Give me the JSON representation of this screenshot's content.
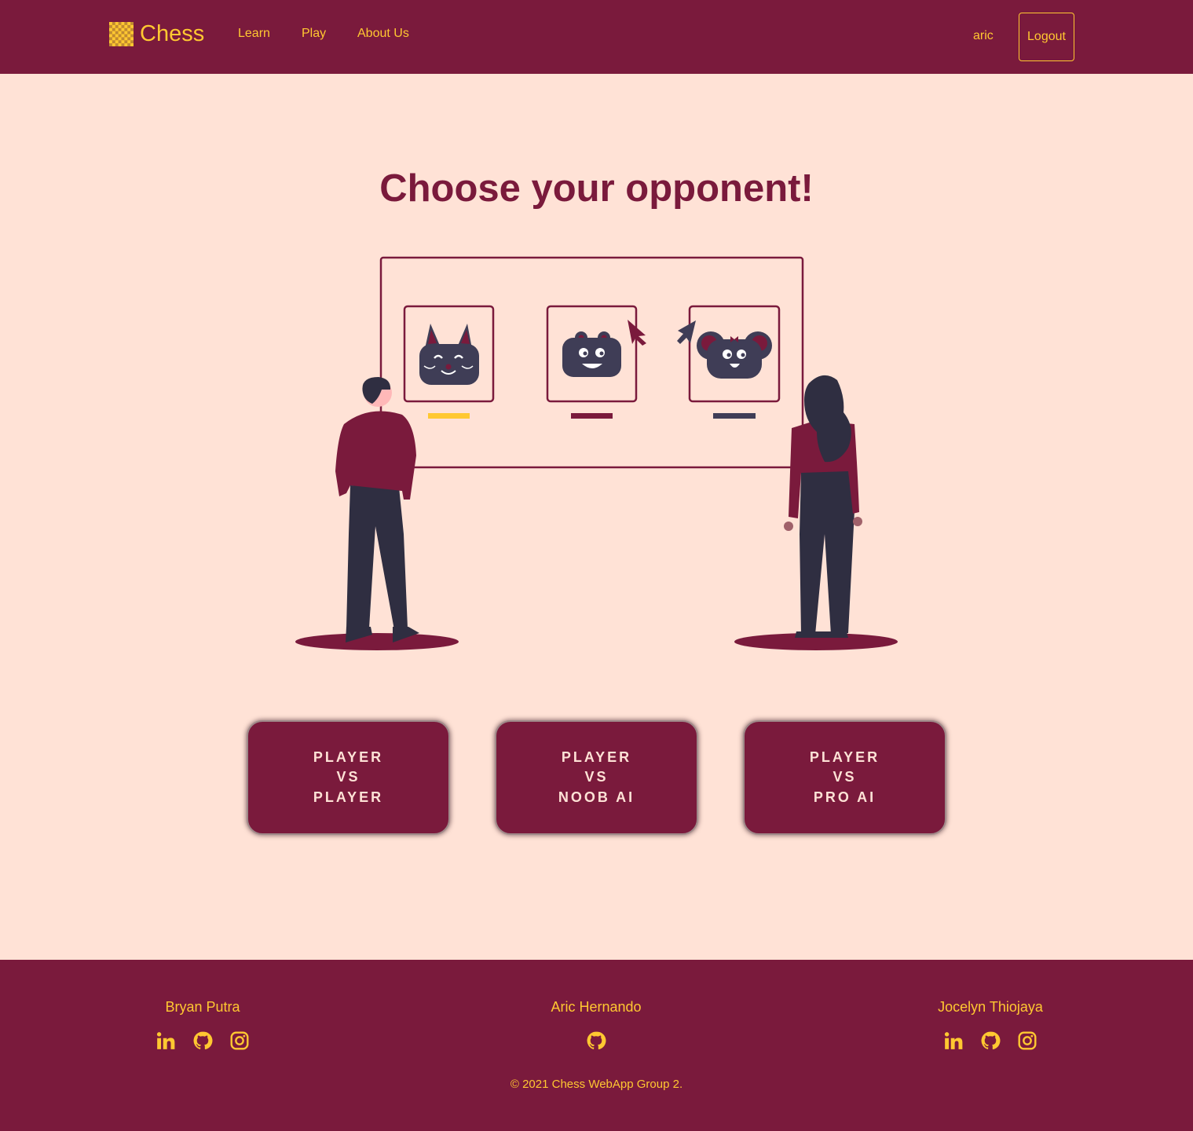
{
  "header": {
    "brand": "Chess",
    "nav": [
      {
        "label": "Learn"
      },
      {
        "label": "Play"
      },
      {
        "label": "About Us"
      }
    ],
    "user": "aric",
    "logout_label": "Logout"
  },
  "main": {
    "title": "Choose your opponent!",
    "modes": [
      {
        "line1": "PLAYER",
        "line2": "VS",
        "line3": "PLAYER"
      },
      {
        "line1": "PLAYER",
        "line2": "VS",
        "line3": "NOOB AI"
      },
      {
        "line1": "PLAYER",
        "line2": "VS",
        "line3": "PRO AI"
      }
    ]
  },
  "footer": {
    "members": [
      {
        "name": "Bryan Putra",
        "icons": [
          "linkedin-icon",
          "github-icon",
          "instagram-icon"
        ]
      },
      {
        "name": "Aric Hernando",
        "icons": [
          "github-icon"
        ]
      },
      {
        "name": "Jocelyn Thiojaya",
        "icons": [
          "linkedin-icon",
          "github-icon",
          "instagram-icon"
        ]
      }
    ],
    "copyright": "© 2021 Chess WebApp Group 2."
  },
  "colors": {
    "primary": "#7a1a3c",
    "accent": "#ffc831",
    "background": "#ffe2d6",
    "dark": "#2f2e41"
  }
}
